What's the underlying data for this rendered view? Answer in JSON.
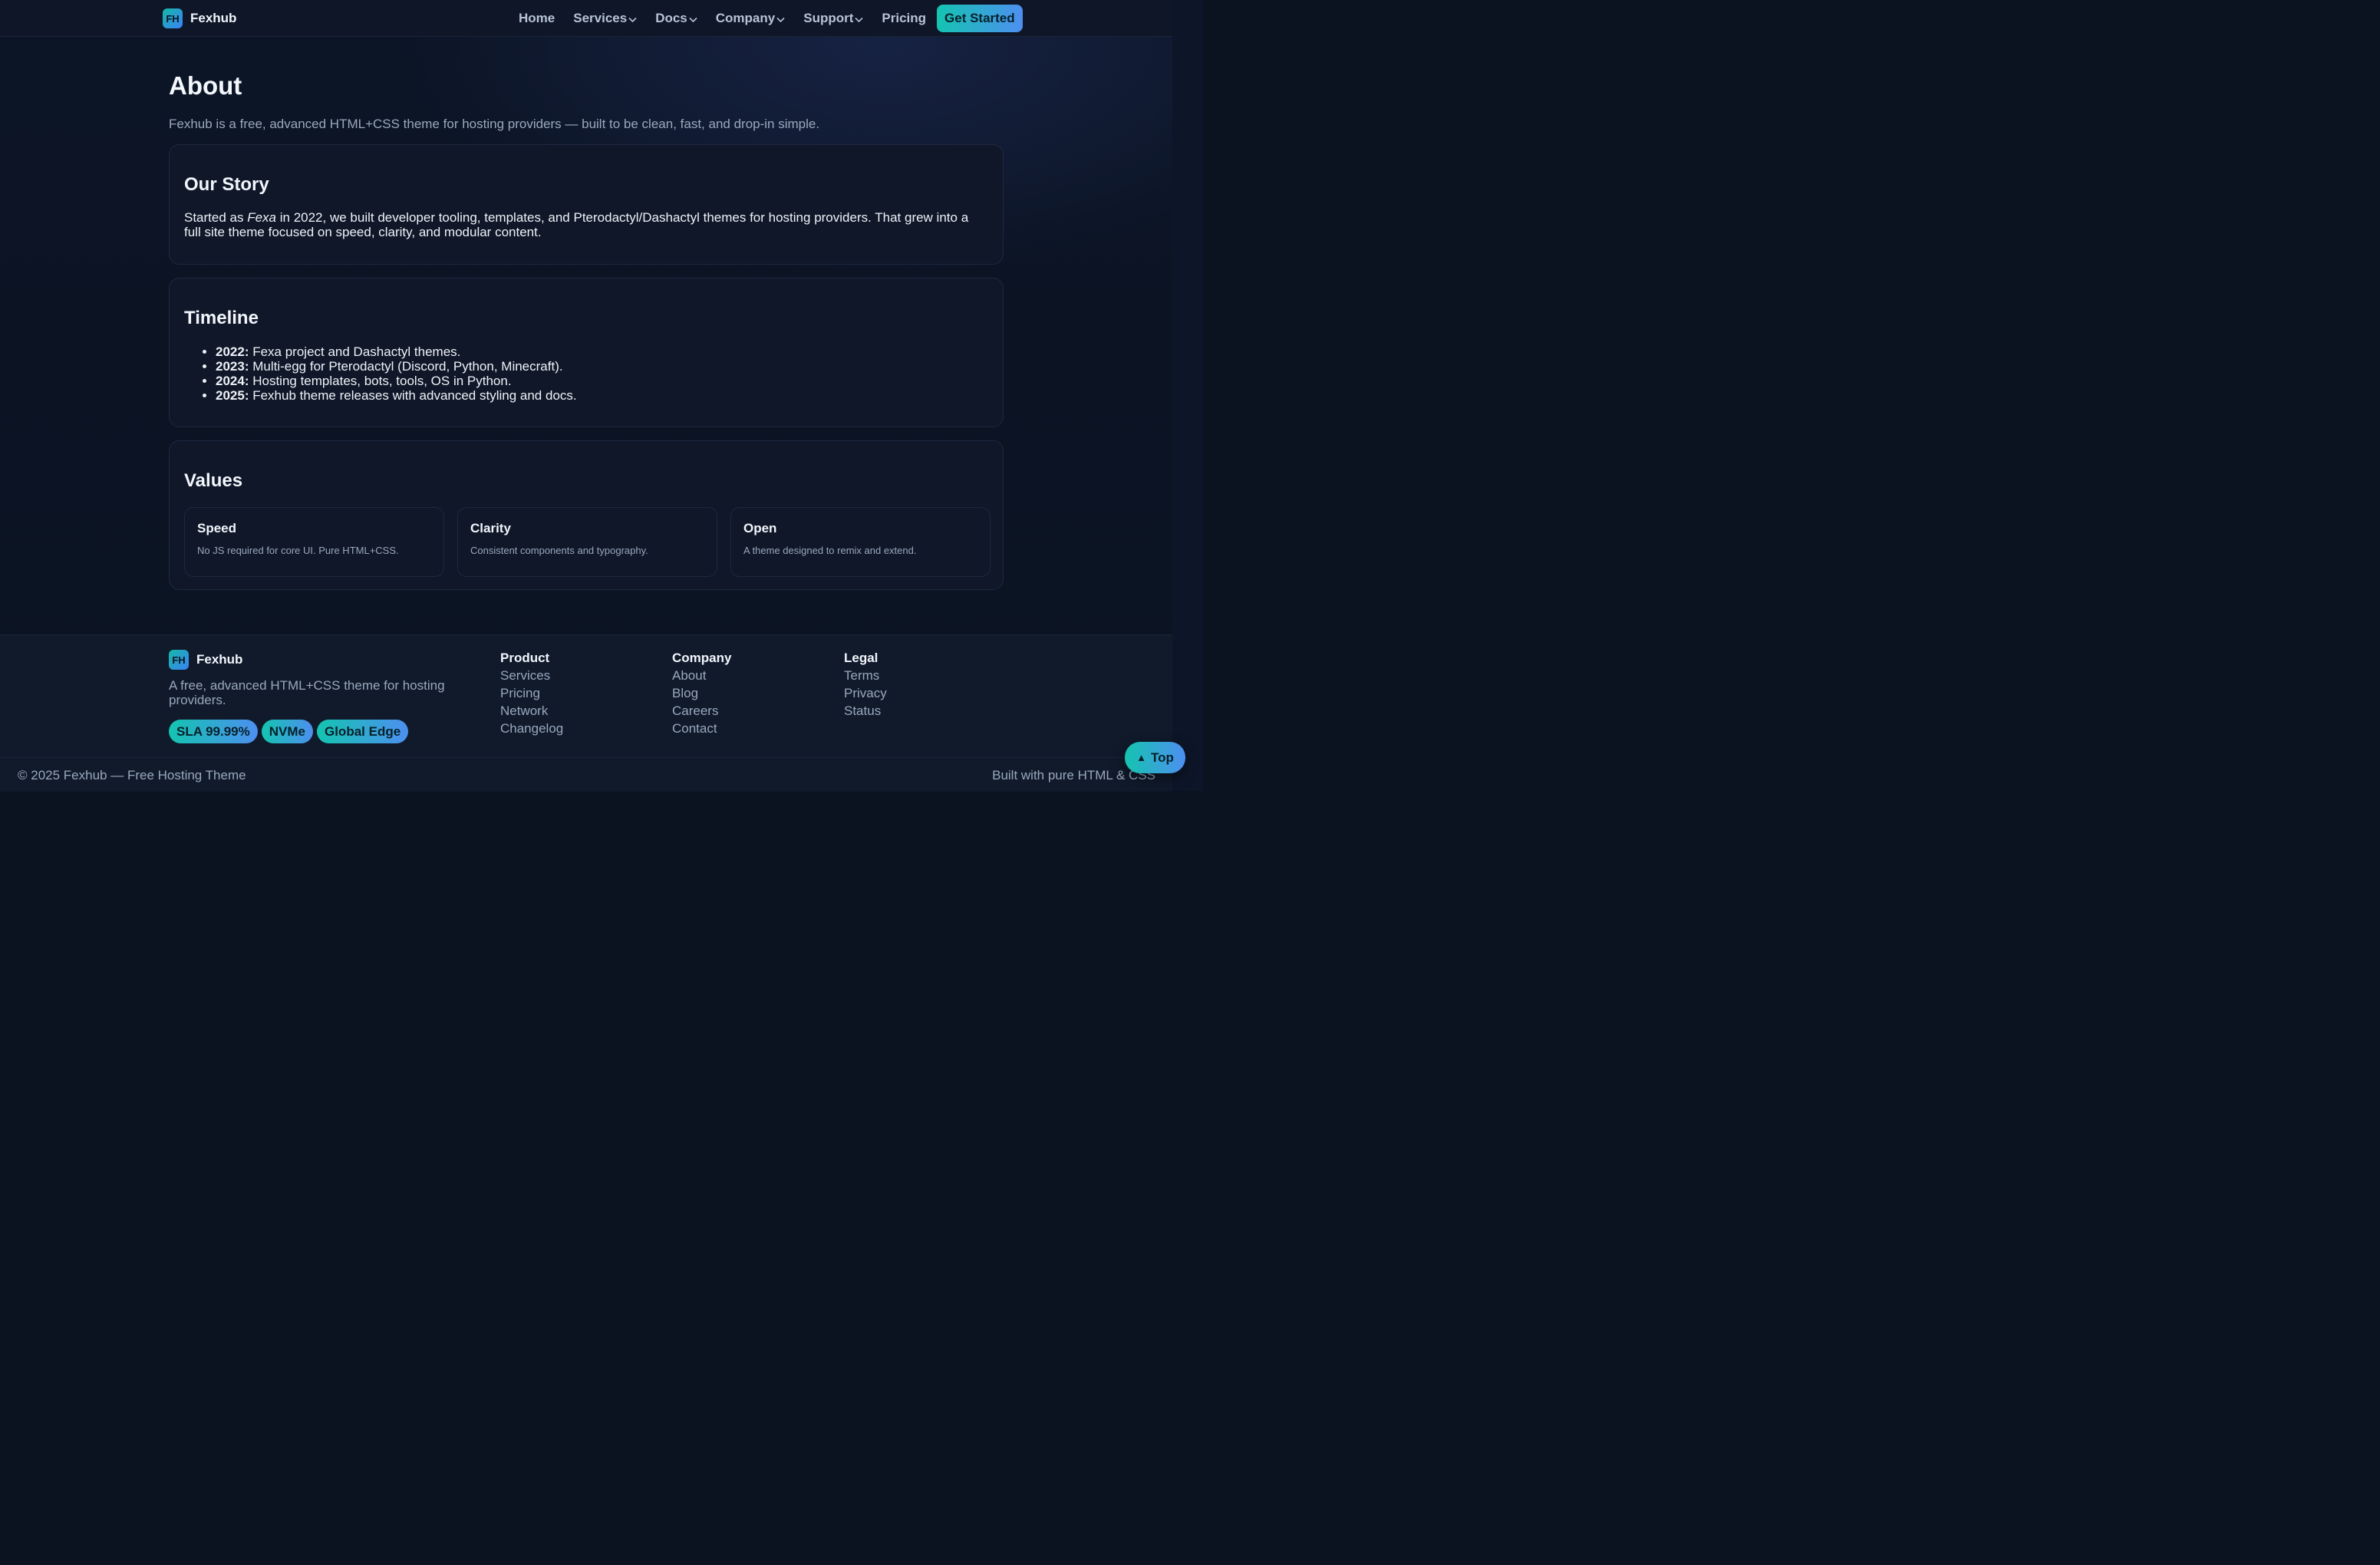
{
  "brand": {
    "badge": "FH",
    "name": "Fexhub"
  },
  "nav": {
    "items": [
      {
        "label": "Home",
        "dropdown": false
      },
      {
        "label": "Services",
        "dropdown": true
      },
      {
        "label": "Docs",
        "dropdown": true
      },
      {
        "label": "Company",
        "dropdown": true
      },
      {
        "label": "Support",
        "dropdown": true
      },
      {
        "label": "Pricing",
        "dropdown": false
      }
    ],
    "cta": "Get Started"
  },
  "page": {
    "title": "About",
    "intro": "Fexhub is a free, advanced HTML+CSS theme for hosting providers — built to be clean, fast, and drop-in simple."
  },
  "story": {
    "heading": "Our Story",
    "text_before": "Started as ",
    "text_em": "Fexa",
    "text_after": " in 2022, we built developer tooling, templates, and Pterodactyl/Dashactyl themes for hosting providers. That grew into a full site theme focused on speed, clarity, and modular content."
  },
  "timeline": {
    "heading": "Timeline",
    "items": [
      {
        "year": "2022:",
        "text": " Fexa project and Dashactyl themes."
      },
      {
        "year": "2023:",
        "text": " Multi-egg for Pterodactyl (Discord, Python, Minecraft)."
      },
      {
        "year": "2024:",
        "text": " Hosting templates, bots, tools, OS in Python."
      },
      {
        "year": "2025:",
        "text": " Fexhub theme releases with advanced styling and docs."
      }
    ]
  },
  "values": {
    "heading": "Values",
    "items": [
      {
        "title": "Speed",
        "desc": "No JS required for core UI. Pure HTML+CSS."
      },
      {
        "title": "Clarity",
        "desc": "Consistent components and typography."
      },
      {
        "title": "Open",
        "desc": "A theme designed to remix and extend."
      }
    ]
  },
  "footer": {
    "desc": "A free, advanced HTML+CSS theme for hosting providers.",
    "badges": [
      "SLA 99.99%",
      "NVMe",
      "Global Edge"
    ],
    "columns": [
      {
        "title": "Product",
        "links": [
          "Services",
          "Pricing",
          "Network",
          "Changelog"
        ]
      },
      {
        "title": "Company",
        "links": [
          "About",
          "Blog",
          "Careers",
          "Contact"
        ]
      },
      {
        "title": "Legal",
        "links": [
          "Terms",
          "Privacy",
          "Status"
        ]
      }
    ],
    "copyright": "© 2025 Fexhub — Free Hosting Theme",
    "built": "Built with pure HTML & CSS"
  },
  "top_button": {
    "icon": "up-arrow-icon",
    "label": "Top"
  },
  "colors": {
    "background": "#0b1220",
    "accent_start": "#14c4b0",
    "accent_end": "#4d8ff0",
    "muted_text": "#9aa8bd"
  }
}
